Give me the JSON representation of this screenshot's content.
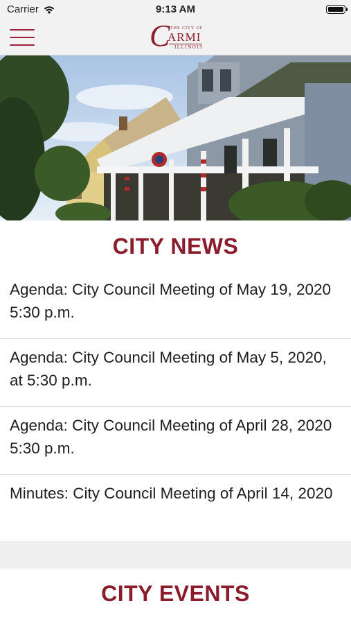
{
  "status_bar": {
    "carrier": "Carrier",
    "time": "9:13 AM"
  },
  "nav": {
    "menu_icon": "hamburger-menu-icon",
    "logo": {
      "prefix": "THE CITY OF",
      "initial": "C",
      "name": "ARMI",
      "state": "ILLINOIS"
    }
  },
  "hero": {
    "description_icon": "victorian-house-photo"
  },
  "news": {
    "title": "CITY NEWS",
    "items": [
      "Agenda: City Council Meeting of  May 19, 2020 5:30 p.m.",
      "Agenda: City Council Meeting of May 5, 2020, at 5:30 p.m.",
      "Agenda: City Council Meeting of April 28, 2020 5:30 p.m.",
      "Minutes: City Council Meeting of April 14, 2020"
    ]
  },
  "events": {
    "title": "CITY EVENTS"
  },
  "colors": {
    "brand": "#8a1c2b",
    "menu_accent": "#9b2335",
    "bar_background": "#f2f2f2",
    "divider": "#d9d9d9"
  }
}
